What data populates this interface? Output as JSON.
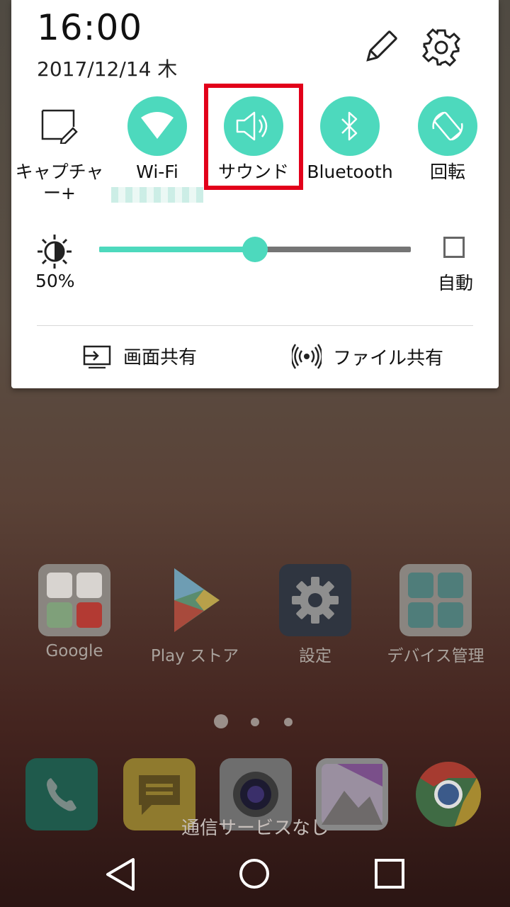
{
  "status": {
    "time": "16:00",
    "date": "2017/12/14 木"
  },
  "tiles": [
    {
      "label": "キャプチャー+"
    },
    {
      "label": "Wi-Fi"
    },
    {
      "label": "サウンド"
    },
    {
      "label": "Bluetooth"
    },
    {
      "label": "回転"
    }
  ],
  "brightness": {
    "value_label": "50%",
    "auto_label": "自動",
    "level": 0.5
  },
  "actions": {
    "screen_share": "画面共有",
    "file_share": "ファイル共有"
  },
  "apps": [
    {
      "label": "Google"
    },
    {
      "label": "Play ストア"
    },
    {
      "label": "設定"
    },
    {
      "label": "デバイス管理"
    }
  ],
  "notice": "通信サービスなし",
  "colors": {
    "accent": "#4dd9bd",
    "highlight": "#e2001a"
  },
  "icons": [
    "pencil-icon",
    "gear-icon",
    "capture-icon",
    "wifi-icon",
    "speaker-icon",
    "bluetooth-icon",
    "rotate-icon",
    "brightness-icon",
    "screen-share-icon",
    "nfc-share-icon",
    "phone-icon",
    "message-icon",
    "camera-icon",
    "gallery-icon",
    "chrome-icon",
    "back-icon",
    "home-icon",
    "recents-icon"
  ]
}
